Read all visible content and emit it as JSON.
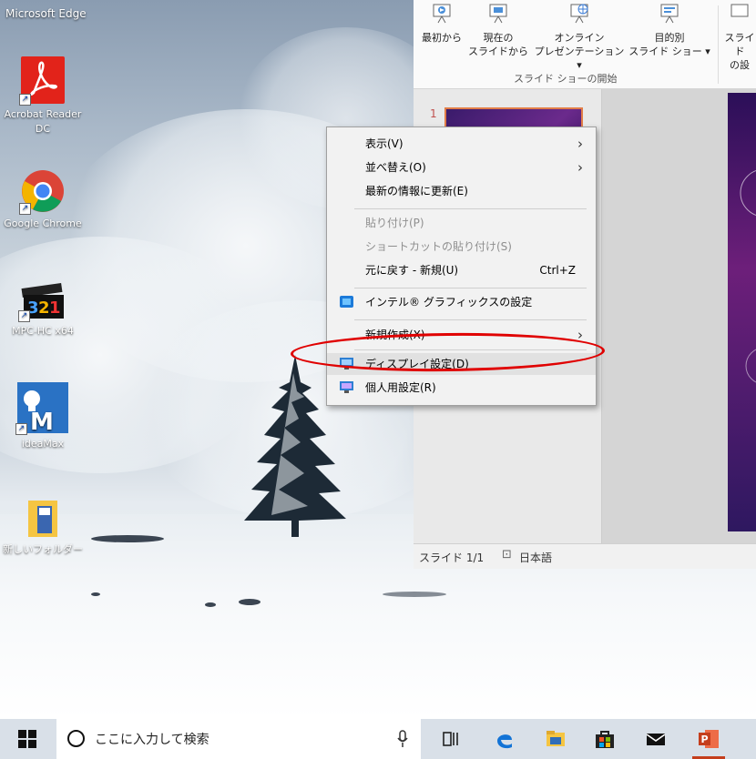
{
  "desktop": {
    "top_label": "Microsoft Edge",
    "icons": [
      {
        "label": "Acrobat Reader DC",
        "icon": "acrobat-icon"
      },
      {
        "label": "Google Chrome",
        "icon": "chrome-icon"
      },
      {
        "label": "MPC-HC x64",
        "icon": "mpc-hc-icon"
      },
      {
        "label": "ideaMax",
        "icon": "ideamax-icon"
      },
      {
        "label": "新しいフォルダー",
        "icon": "folder-icon"
      }
    ]
  },
  "powerpoint": {
    "ribbon": {
      "buttons": [
        {
          "label1": "最初から",
          "label2": "",
          "icon": "slideshow-from-start-icon"
        },
        {
          "label1": "現在の",
          "label2": "スライドから",
          "icon": "slideshow-from-current-icon"
        },
        {
          "label1": "オンライン",
          "label2": "プレゼンテーション ▾",
          "icon": "online-presentation-icon"
        },
        {
          "label1": "目的別",
          "label2": "スライド ショー ▾",
          "icon": "custom-slideshow-icon"
        },
        {
          "label1": "スライド",
          "label2": "の設",
          "icon": "slideshow-setup-icon"
        }
      ],
      "group_label": "スライド ショーの開始"
    },
    "thumbnail_number": "1",
    "status": {
      "slide": "スライド 1/1",
      "language": "日本語"
    }
  },
  "context_menu": {
    "items": [
      {
        "label": "表示(V)",
        "submenu": true
      },
      {
        "label": "並べ替え(O)",
        "submenu": true
      },
      {
        "label": "最新の情報に更新(E)"
      },
      {
        "label": "貼り付け(P)",
        "disabled": true
      },
      {
        "label": "ショートカットの貼り付け(S)",
        "disabled": true
      },
      {
        "label": "元に戻す - 新規(U)",
        "accel": "Ctrl+Z"
      },
      {
        "label": "インテル® グラフィックスの設定",
        "icon": "intel-graphics-icon"
      },
      {
        "label": "新規作成(X)",
        "submenu": true
      },
      {
        "label": "ディスプレイ設定(D)",
        "icon": "display-settings-icon",
        "highlighted": true
      },
      {
        "label": "個人用設定(R)",
        "icon": "personalize-icon"
      }
    ],
    "highlight_color": "#e00000"
  },
  "taskbar": {
    "search_placeholder": "ここに入力して検索",
    "icons": [
      "windows-start-icon",
      "microphone-icon",
      "task-view-icon",
      "edge-icon",
      "file-explorer-icon",
      "store-icon",
      "mail-icon",
      "powerpoint-icon"
    ]
  }
}
